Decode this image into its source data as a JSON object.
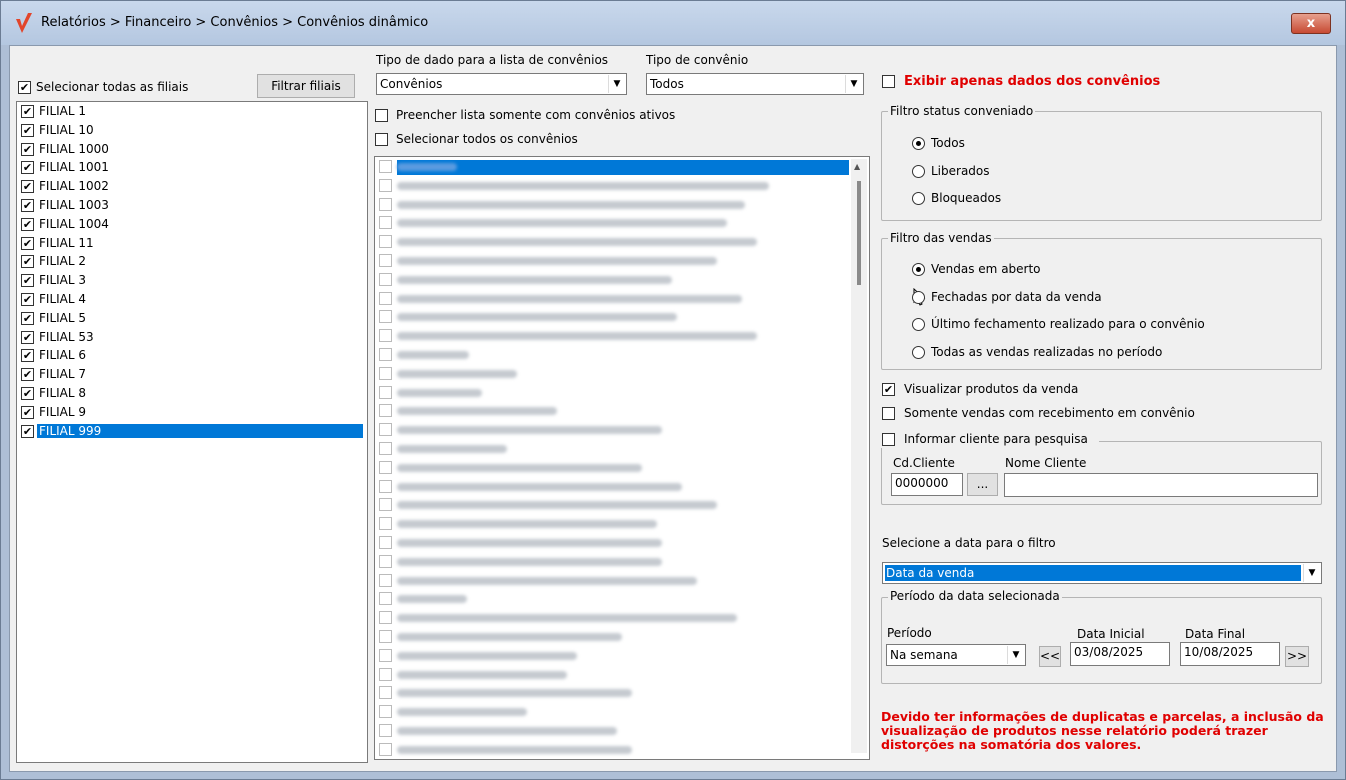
{
  "window": {
    "title": "Relatórios > Financeiro > Convênios > Convênios dinâmico",
    "close_label": "x"
  },
  "filiais": {
    "select_all_label": "Selecionar todas as filiais",
    "filter_button": "Filtrar filiais",
    "items": [
      "FILIAL 1",
      "FILIAL 10",
      "FILIAL 1000",
      "FILIAL 1001",
      "FILIAL 1002",
      "FILIAL 1003",
      "FILIAL 1004",
      "FILIAL 11",
      "FILIAL 2",
      "FILIAL 3",
      "FILIAL 4",
      "FILIAL 5",
      "FILIAL 53",
      "FILIAL 6",
      "FILIAL 7",
      "FILIAL 8",
      "FILIAL 9",
      "FILIAL 999"
    ],
    "selected": "FILIAL 999"
  },
  "convenios": {
    "tipo_dado_label": "Tipo de dado para a lista de convênios",
    "tipo_dado_value": "Convênios",
    "tipo_convenio_label": "Tipo de convênio",
    "tipo_convenio_value": "Todos",
    "somente_ativos_label": "Preencher lista somente com convênios ativos",
    "selecionar_todos_label": "Selecionar todos os convênios",
    "row_count": 32
  },
  "right": {
    "exibir_label": "Exibir apenas dados dos convênios",
    "status_group": "Filtro status conveniado",
    "status_options": [
      "Todos",
      "Liberados",
      "Bloqueados"
    ],
    "status_selected": 0,
    "vendas_group": "Filtro das vendas",
    "vendas_options": [
      "Vendas em aberto",
      "Fechadas por data da venda",
      "Último fechamento realizado para o convênio",
      "Todas as vendas realizadas no período"
    ],
    "vendas_selected": 0,
    "visualizar_produtos_label": "Visualizar produtos da venda",
    "visualizar_produtos_checked": true,
    "somente_recebimento_label": "Somente vendas com recebimento em convênio",
    "informar_cliente_label": "Informar cliente para pesquisa",
    "cd_cliente_label": "Cd.Cliente",
    "cd_cliente_value": "0000000",
    "browse_button": "...",
    "nome_cliente_label": "Nome Cliente",
    "nome_cliente_value": "",
    "data_filtro_label": "Selecione a data para o filtro",
    "data_filtro_value": "Data da venda",
    "periodo_group": "Período da data selecionada",
    "periodo_label": "Período",
    "periodo_value": "Na semana",
    "prev_button": "<<",
    "next_button": ">>",
    "data_inicial_label": "Data Inicial",
    "data_inicial_value": "03/08/2025",
    "data_final_label": "Data Final",
    "data_final_value": "10/08/2025",
    "warning": "Devido ter informações de duplicatas e parcelas, a inclusão da visualização de produtos nesse relatório poderá trazer distorções na somatória dos valores."
  }
}
